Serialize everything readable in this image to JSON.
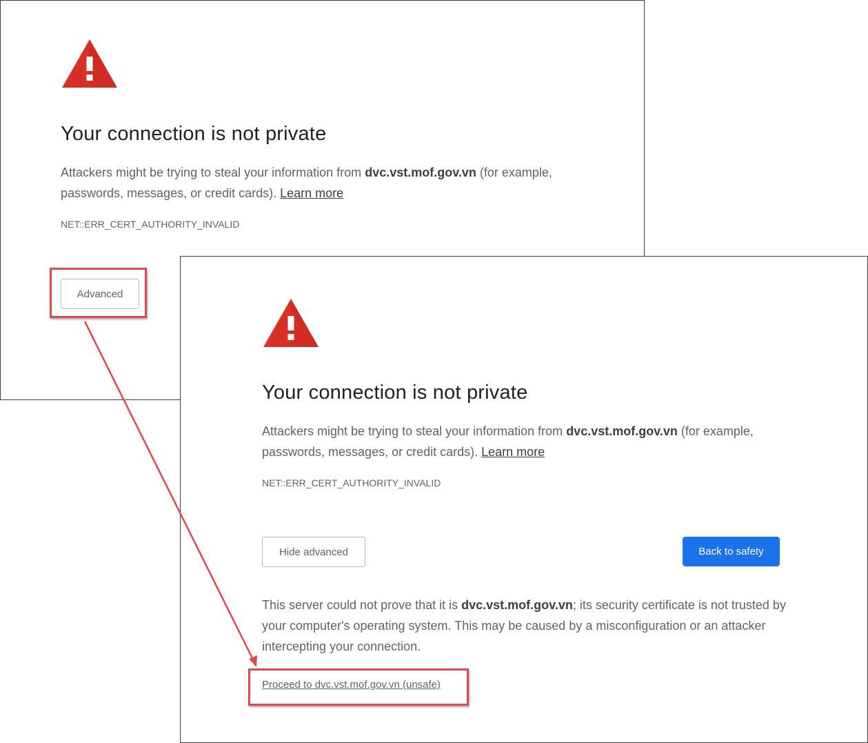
{
  "back_panel": {
    "title": "Your connection is not private",
    "desc_prefix": "Attackers might be trying to steal your information from ",
    "domain": "dvc.vst.mof.gov.vn",
    "desc_suffix": " (for example, passwords, messages, or credit cards). ",
    "learn_more": "Learn more",
    "error_code": "NET::ERR_CERT_AUTHORITY_INVALID",
    "advanced_button": "Advanced"
  },
  "front_panel": {
    "title": "Your connection is not private",
    "desc_prefix": "Attackers might be trying to steal your information from ",
    "domain": "dvc.vst.mof.gov.vn",
    "desc_suffix": " (for example, passwords, messages, or credit cards). ",
    "learn_more": "Learn more",
    "error_code": "NET::ERR_CERT_AUTHORITY_INVALID",
    "hide_advanced_button": "Hide advanced",
    "back_to_safety_button": "Back to safety",
    "details_prefix": "This server could not prove that it is ",
    "details_domain": "dvc.vst.mof.gov.vn",
    "details_suffix": "; its security certificate is not trusted by your computer's operating system. This may be caused by a misconfiguration or an attacker intercepting your connection.",
    "proceed_link": "Proceed to dvc.vst.mof.gov.vn (unsafe)"
  },
  "colors": {
    "warning_red": "#d93025",
    "annotation_red": "#e0484d",
    "primary_blue": "#1a73e8"
  },
  "icons": {
    "warning": "warning-triangle-icon",
    "arrow": "annotation-arrow"
  }
}
